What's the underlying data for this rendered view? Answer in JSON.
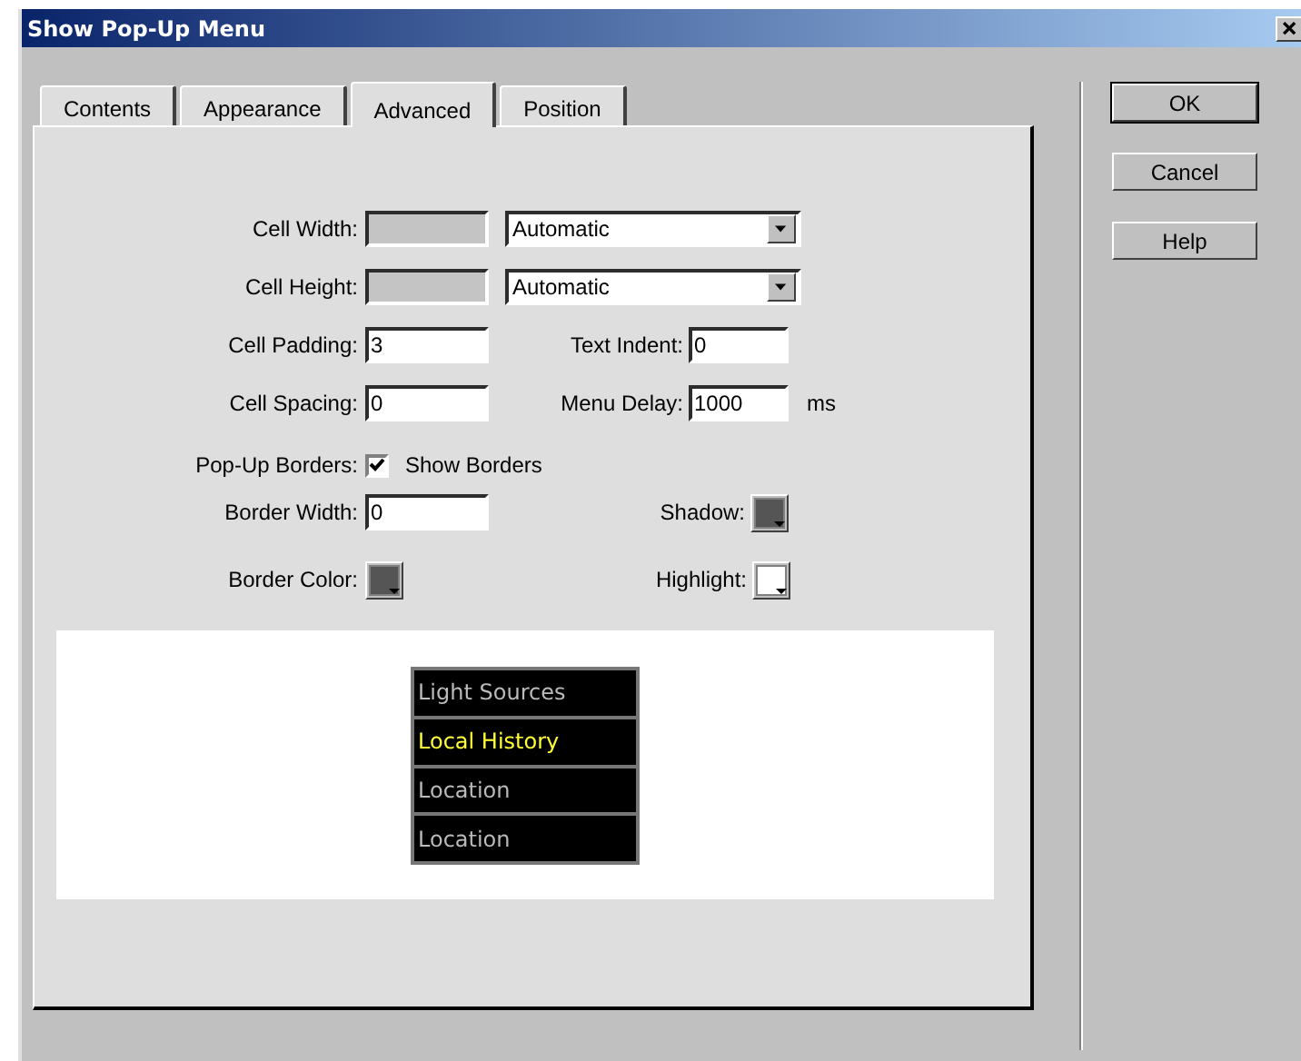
{
  "window": {
    "title": "Show Pop-Up Menu"
  },
  "tabs": [
    {
      "label": "Contents",
      "selected": false
    },
    {
      "label": "Appearance",
      "selected": false
    },
    {
      "label": "Advanced",
      "selected": true
    },
    {
      "label": "Position",
      "selected": false
    }
  ],
  "cell_width": {
    "label": "Cell Width:",
    "disabled": true,
    "select": "Automatic"
  },
  "cell_height": {
    "label": "Cell Height:",
    "disabled": true,
    "select": "Automatic"
  },
  "cell_padding": {
    "label": "Cell Padding:",
    "value": "3"
  },
  "text_indent": {
    "label": "Text Indent:",
    "value": "0"
  },
  "cell_spacing": {
    "label": "Cell Spacing:",
    "value": "0"
  },
  "menu_delay": {
    "label": "Menu Delay:",
    "value": "1000",
    "unit": "ms"
  },
  "popup_borders": {
    "label": "Pop-Up Borders:",
    "checkbox_label": "Show Borders",
    "checked": true
  },
  "border_width": {
    "label": "Border Width:",
    "value": "0"
  },
  "shadow": {
    "label": "Shadow:",
    "color": "#555555"
  },
  "border_color": {
    "label": "Border Color:",
    "color": "#555555"
  },
  "highlight": {
    "label": "Highlight:",
    "color": "#ffffff"
  },
  "preview": {
    "items": [
      {
        "label": "Light Sources",
        "highlighted": false
      },
      {
        "label": "Local History",
        "highlighted": true
      },
      {
        "label": "Location",
        "highlighted": false
      },
      {
        "label": "Location",
        "highlighted": false
      }
    ]
  },
  "buttons": [
    "OK",
    "Cancel",
    "Help"
  ]
}
